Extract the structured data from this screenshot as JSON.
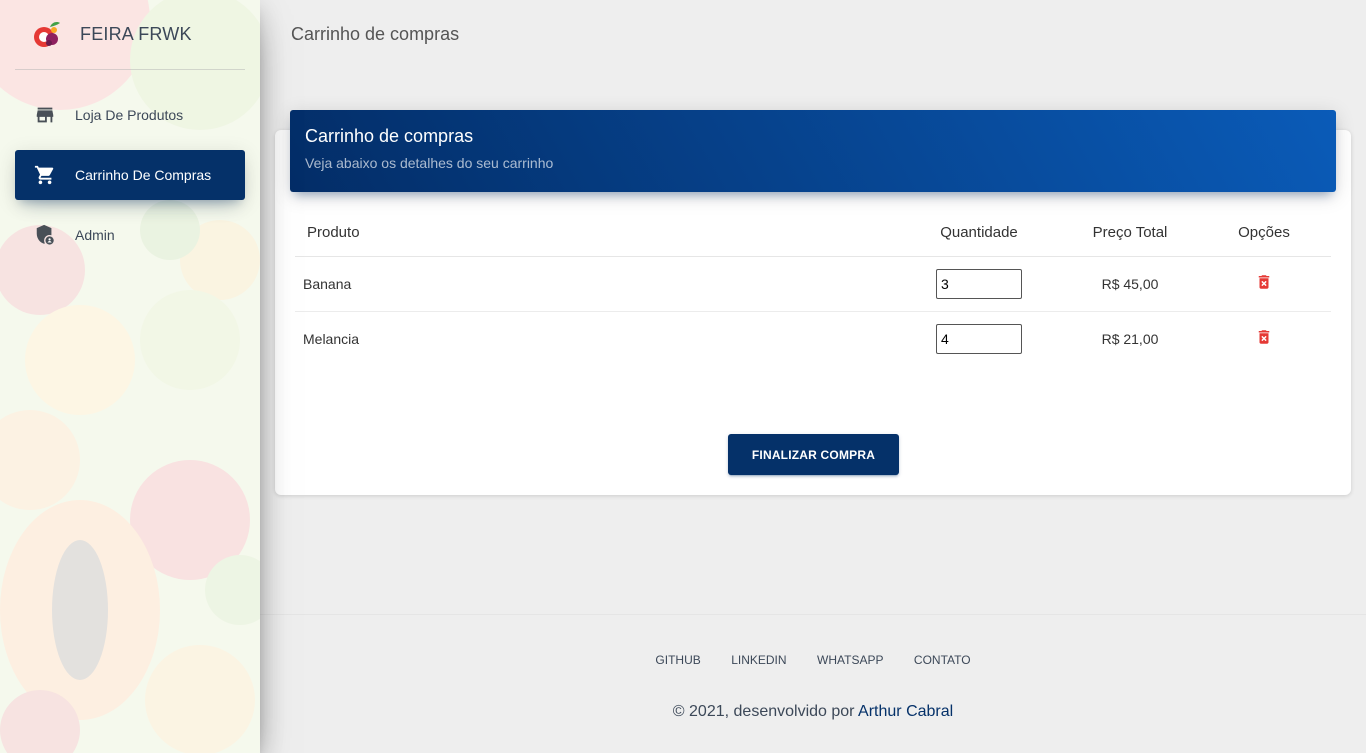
{
  "app": {
    "brand_name": "FEIRA FRWK",
    "page_title": "Carrinho de compras"
  },
  "sidebar": {
    "items": [
      {
        "label": "Loja De Produtos",
        "icon": "store-icon",
        "active": false
      },
      {
        "label": "Carrinho De Compras",
        "icon": "shopping-cart-icon",
        "active": true
      },
      {
        "label": "Admin",
        "icon": "admin-shield-icon",
        "active": false
      }
    ]
  },
  "card": {
    "title": "Carrinho de compras",
    "subtitle": "Veja abaixo os detalhes do seu carrinho",
    "columns": {
      "product": "Produto",
      "quantity": "Quantidade",
      "total": "Preço Total",
      "options": "Opções"
    },
    "rows": [
      {
        "product": "Banana",
        "quantity": "3",
        "total": "R$ 45,00"
      },
      {
        "product": "Melancia",
        "quantity": "4",
        "total": "R$ 21,00"
      }
    ],
    "finalize_label": "FINALIZAR COMPRA"
  },
  "footer": {
    "links": [
      "GITHUB",
      "LINKEDIN",
      "WHATSAPP",
      "CONTATO"
    ],
    "copyright": "© 2021, desenvolvido por",
    "author": "Arthur Cabral"
  },
  "colors": {
    "primary": "#053169",
    "delete": "#e53935"
  }
}
